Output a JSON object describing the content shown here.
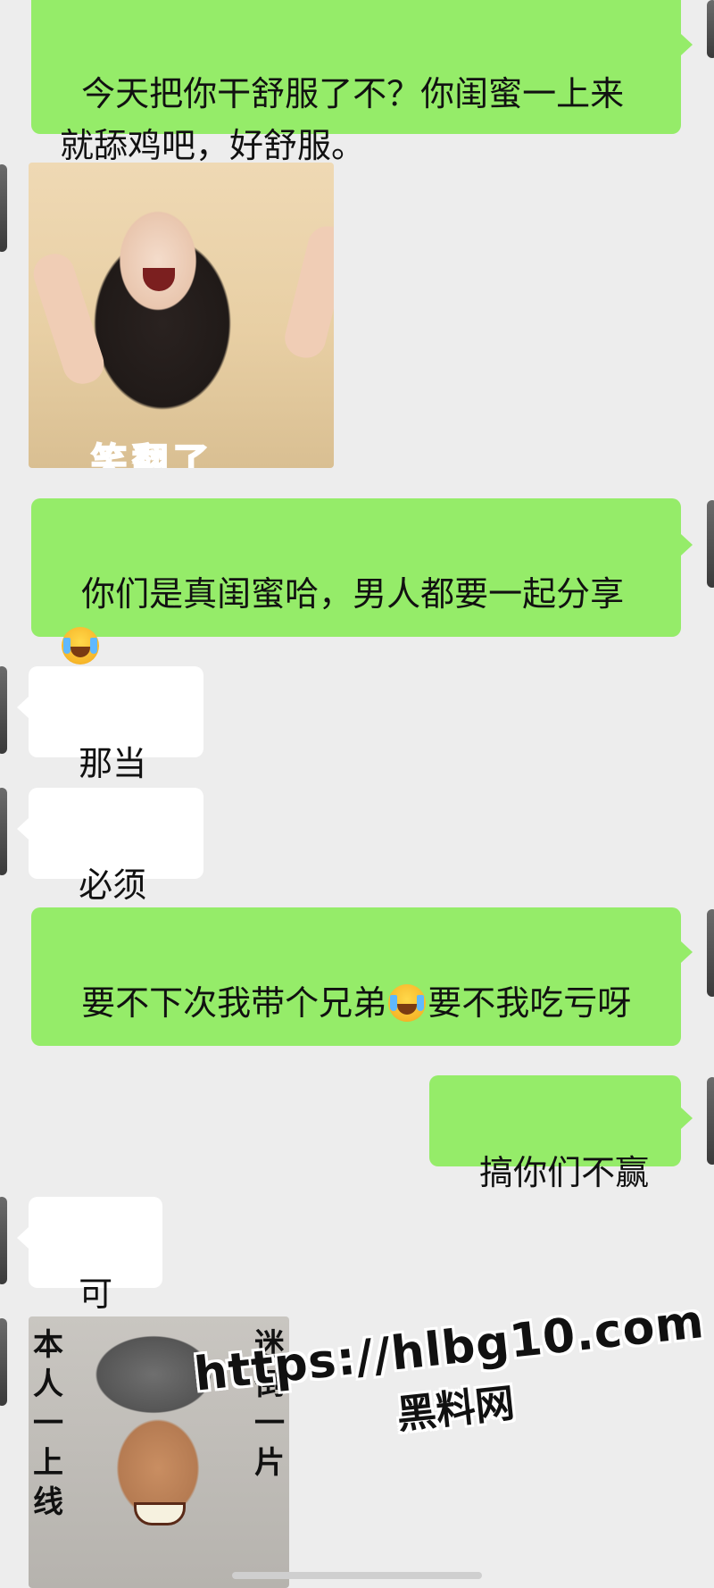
{
  "chat": {
    "messages": [
      {
        "side": "out",
        "type": "text",
        "text": "今天把你干舒服了不？你闺蜜一上来就舔鸡吧，好舒服。"
      },
      {
        "side": "in",
        "type": "image",
        "image_caption": "笑翻了"
      },
      {
        "side": "out",
        "type": "text",
        "text_before": "你们是真闺蜜哈，男人都要一起分享",
        "emoji": "face-with-tears-of-joy"
      },
      {
        "side": "in",
        "type": "text",
        "text": "那当然"
      },
      {
        "side": "in",
        "type": "text",
        "text": "必须的"
      },
      {
        "side": "out",
        "type": "text",
        "text_before": "要不下次我带个兄弟",
        "emoji": "face-with-tears-of-joy",
        "text_after": "要不我吃亏呀"
      },
      {
        "side": "out",
        "type": "text",
        "text": "搞你们不赢"
      },
      {
        "side": "in",
        "type": "text",
        "text": "可以"
      },
      {
        "side": "in",
        "type": "image",
        "image_text_left": "本人一上线",
        "image_text_right": "迷倒一片"
      }
    ]
  },
  "watermark": {
    "url": "https://hlbg10.com",
    "site_name": "黑料网"
  },
  "colors": {
    "background": "#ededed",
    "outgoing_bubble": "#95ec69",
    "incoming_bubble": "#ffffff"
  }
}
